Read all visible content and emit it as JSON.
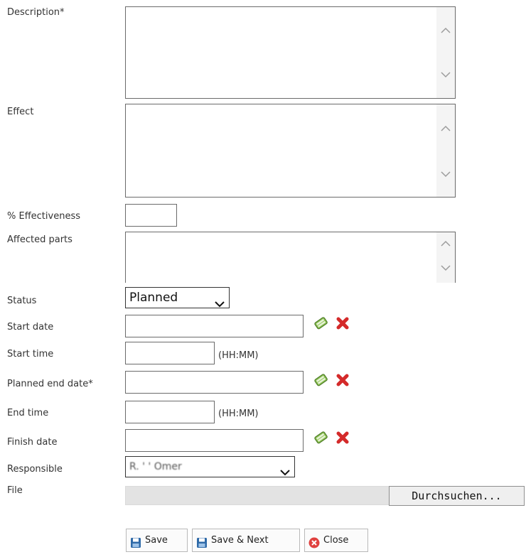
{
  "form": {
    "description_label": "Description*",
    "description_value": "",
    "effect_label": "Effect",
    "effect_value": "",
    "effectiveness_label": "% Effectiveness",
    "effectiveness_value": "",
    "affected_parts_label": "Affected parts",
    "affected_parts_value": "",
    "status_label": "Status",
    "status_value": "Planned",
    "start_date_label": "Start date",
    "start_date_value": "",
    "start_time_label": "Start time",
    "start_time_value": "",
    "start_time_hint": "(HH:MM)",
    "planned_end_date_label": "Planned end date*",
    "planned_end_date_value": "",
    "end_time_label": "End time",
    "end_time_value": "",
    "end_time_hint": "(HH:MM)",
    "finish_date_label": "Finish date",
    "finish_date_value": "",
    "responsible_label": "Responsible",
    "responsible_value": "R. ' ' Omer",
    "file_label": "File",
    "browse_label": "Durchsuchen..."
  },
  "actions": {
    "save_label": "Save",
    "save_next_label": "Save & Next",
    "close_label": "Close"
  },
  "icons": {
    "calendar": "calendar-icon",
    "clear": "clear-date-icon",
    "save": "floppy-disk-icon",
    "close": "close-circle-icon"
  },
  "colors": {
    "field_border": "#6b6b6b",
    "clear_red": "#d42a2a",
    "calendar_green": "#6aa83a",
    "close_red": "#e0413f",
    "save_blue": "#2f6aa8"
  }
}
